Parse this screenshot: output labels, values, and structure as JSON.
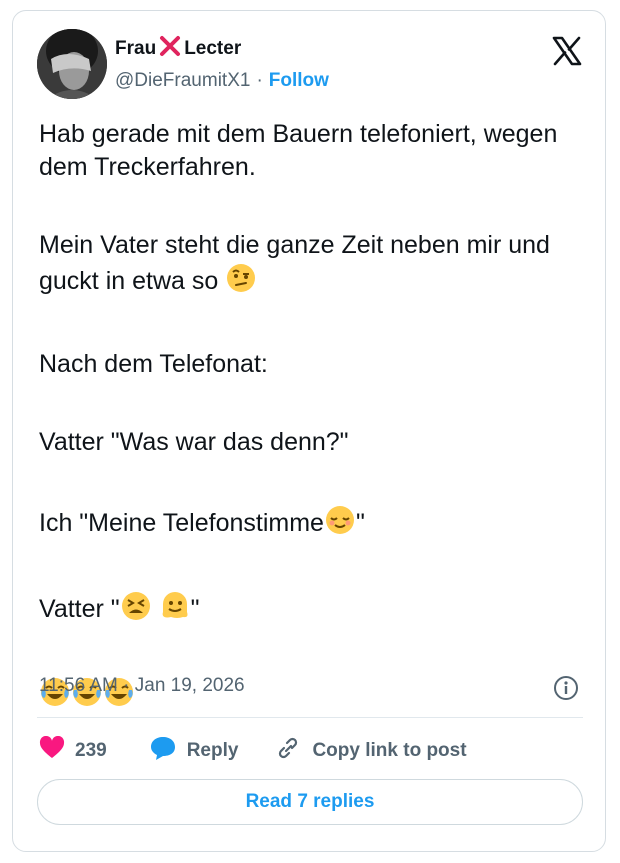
{
  "author": {
    "name_part1": "Frau",
    "name_part2": "Lecter",
    "handle": "@DieFraumitX1",
    "separator": "·",
    "follow_label": "Follow"
  },
  "tweet": {
    "paragraphs": [
      "Hab gerade mit dem Bauern telefoniert, wegen dem Treckerfahren.",
      "Mein Vater steht die ganze Zeit neben mir und guckt in etwa so",
      "Nach dem Telefonat:",
      "Vatter \"Was war das denn?\"",
      "Ich \"Meine Telefonstimme",
      "Vatter \""
    ],
    "quote_close": "\"",
    "timestamp": "11:56 AM · Jan 19, 2026"
  },
  "actions": {
    "likes": "239",
    "reply_label": "Reply",
    "copy_label": "Copy link to post"
  },
  "read_replies_label": "Read 7 replies",
  "colors": {
    "accent": "#1d9bf0",
    "like": "#f91880",
    "muted": "#536471"
  },
  "icons": [
    "x-logo-icon",
    "cross-mark-icon",
    "info-icon",
    "heart-icon",
    "reply-bubble-icon",
    "link-icon",
    "raised-eyebrow-emoji",
    "relieved-face-emoji",
    "tired-face-emoji",
    "melting-face-emoji",
    "joy-emoji"
  ]
}
